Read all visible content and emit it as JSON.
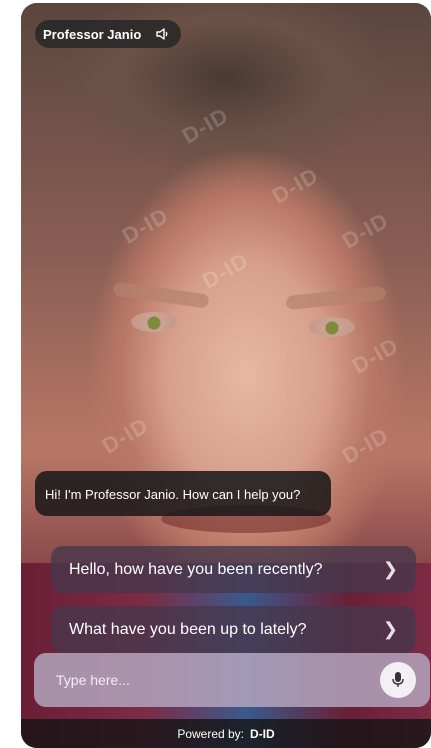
{
  "avatar": {
    "name": "Professor Janio",
    "speaker_icon": "speaker-icon",
    "watermark_text": "D-ID"
  },
  "chat": {
    "greeting": "Hi! I'm Professor Janio. How can I help you?"
  },
  "suggestions": [
    {
      "label": "Hello, how have you been recently?",
      "icon": "chevron-right-icon"
    },
    {
      "label": "What have you been up to lately?",
      "icon": "chevron-right-icon"
    }
  ],
  "input": {
    "placeholder": "Type here...",
    "mic_icon": "microphone-icon"
  },
  "footer": {
    "powered_by": "Powered by:",
    "logo_text": "D-ID"
  },
  "colors": {
    "overlay_dark": "#191919",
    "suggestion_bg": "#46374b",
    "input_bg": "#b4a5be"
  }
}
